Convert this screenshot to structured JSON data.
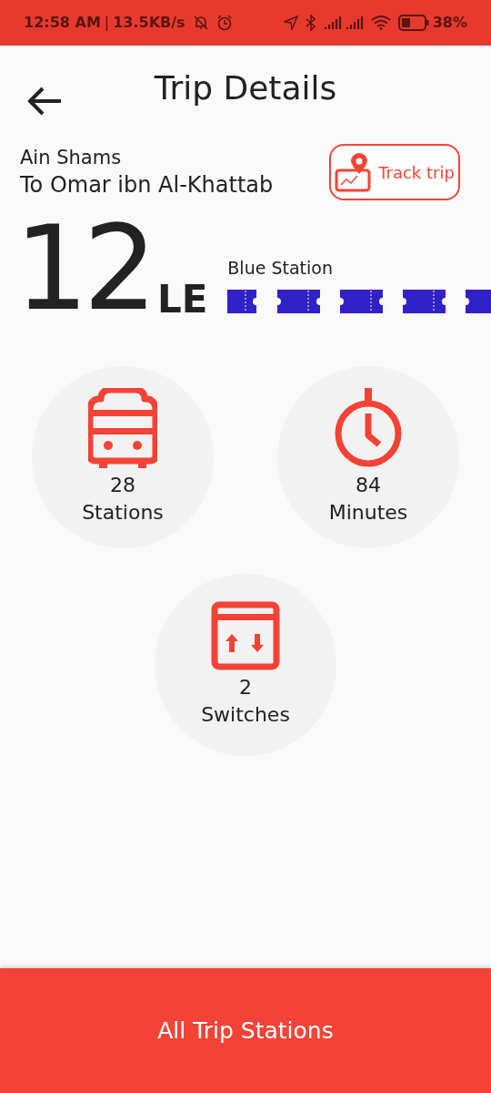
{
  "status_bar": {
    "time": "12:58 AM",
    "divider": "|",
    "speed": "13.5KB/s",
    "battery": "38%"
  },
  "header": {
    "title": "Trip Details"
  },
  "route": {
    "from": "Ain Shams",
    "to": "To Omar ibn Al-Khattab",
    "track_button": "Track trip"
  },
  "fare": {
    "amount": "12",
    "currency": "LE",
    "line": "Blue Station"
  },
  "stats": [
    {
      "kind": "bus",
      "value": "28",
      "label": "Stations"
    },
    {
      "kind": "timer",
      "value": "84",
      "label": "Minutes"
    },
    {
      "kind": "switch",
      "value": "2",
      "label": "Switches"
    }
  ],
  "footer_button": "All Trip Stations"
}
